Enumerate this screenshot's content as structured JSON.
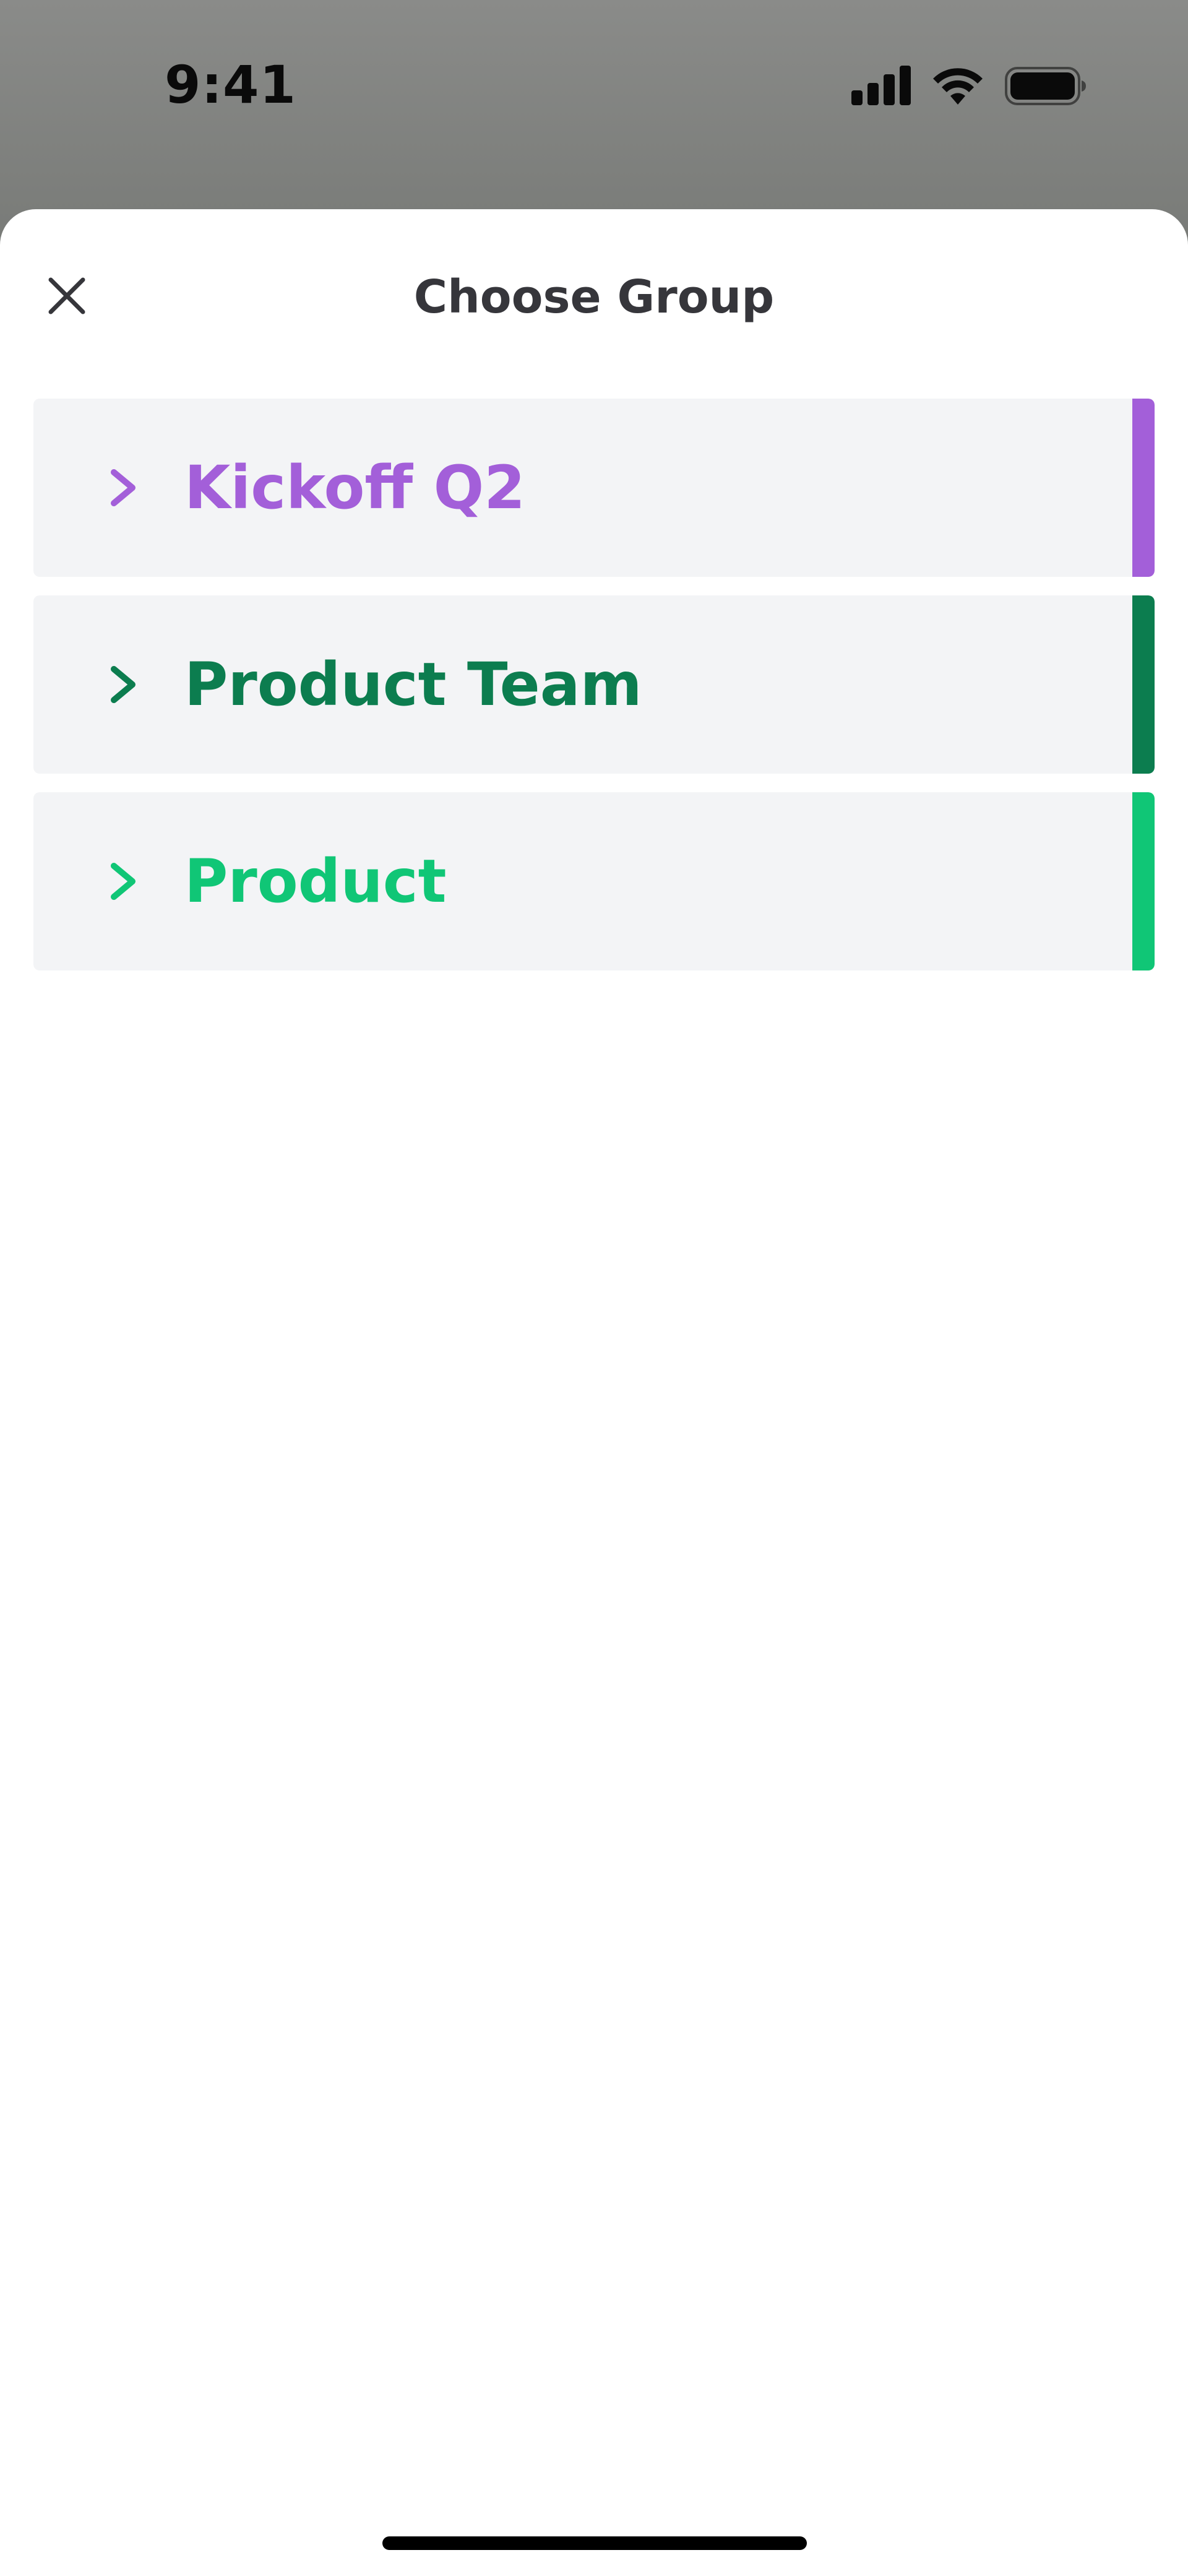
{
  "status_bar": {
    "time": "9:41",
    "icons": [
      "signal-icon",
      "wifi-icon",
      "battery-icon"
    ]
  },
  "sheet": {
    "title": "Choose Group",
    "close_icon": "close-icon"
  },
  "groups": [
    {
      "label": "Kickoff Q2",
      "color": "#a35fd9"
    },
    {
      "label": "Product Team",
      "color": "#0c7d4f"
    },
    {
      "label": "Product",
      "color": "#10c676"
    }
  ],
  "colors": {
    "sheet_background": "#ffffff",
    "item_background": "#f3f4f6",
    "title_text": "#36363b"
  }
}
